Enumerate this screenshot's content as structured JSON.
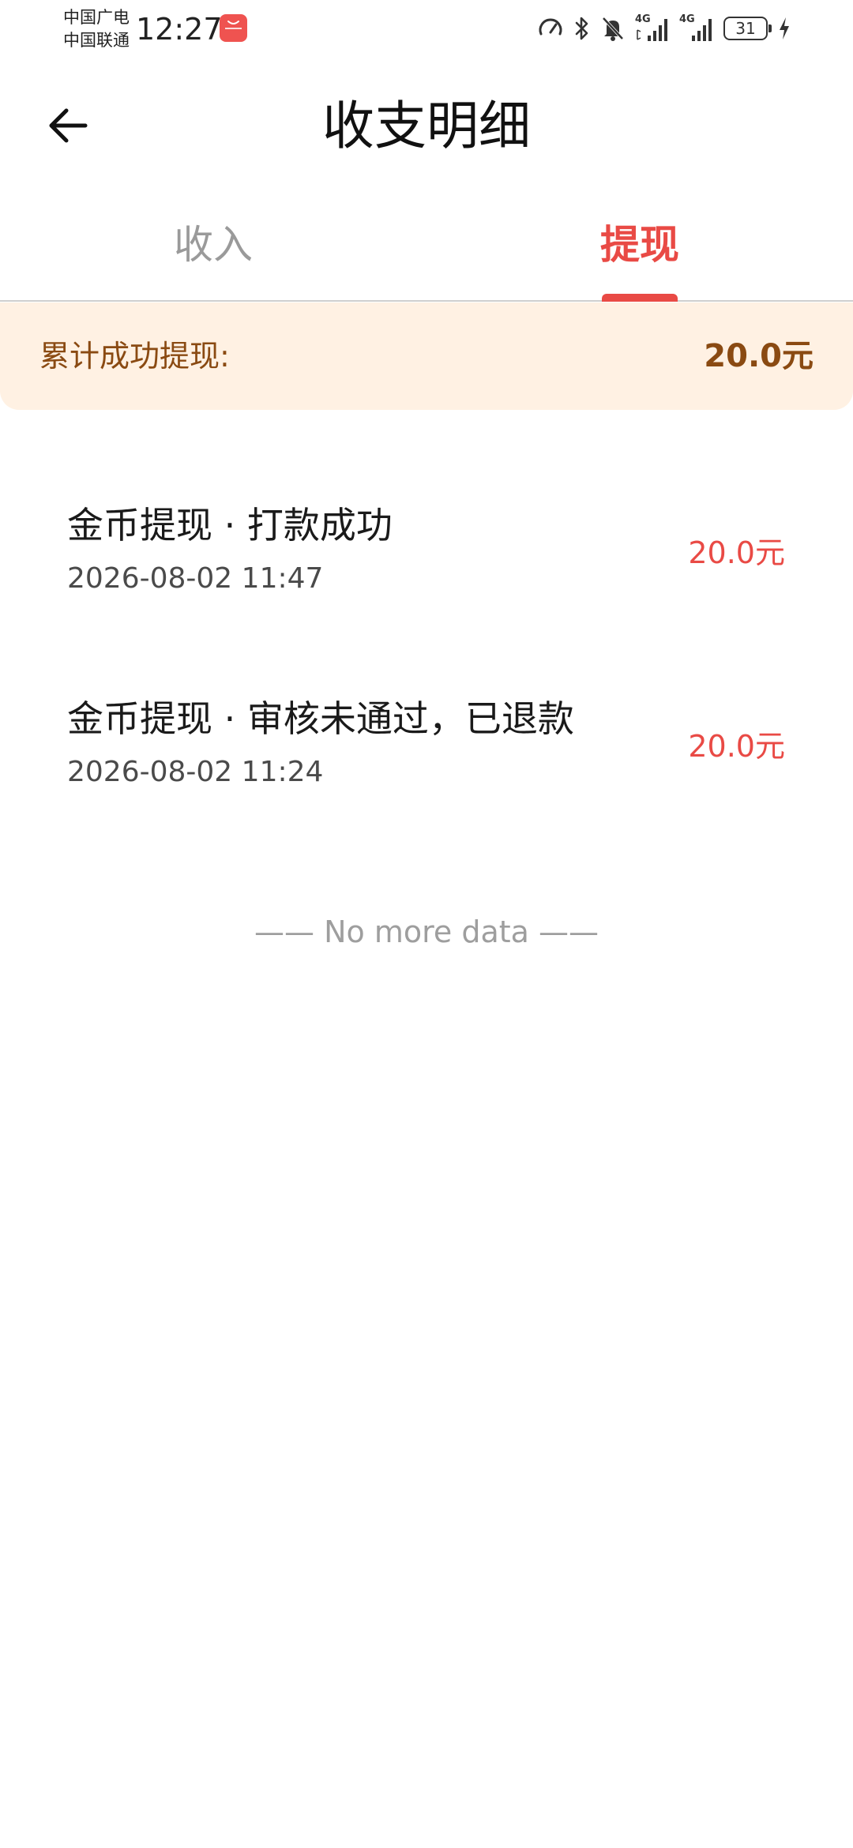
{
  "status_bar": {
    "carrier_1": "中国广电",
    "carrier_2": "中国联通",
    "time": "12:27",
    "network_1": "4G",
    "network_2": "4G",
    "battery": "31",
    "icons": [
      "speed-icon",
      "bluetooth-icon",
      "bell-muted-icon",
      "signal-icon",
      "signal-icon",
      "battery-icon",
      "charging-icon"
    ]
  },
  "header": {
    "title": "收支明细",
    "back_icon": "arrow-left-icon"
  },
  "tabs": [
    {
      "label": "收入",
      "active": false
    },
    {
      "label": "提现",
      "active": true
    }
  ],
  "summary": {
    "label": "累计成功提现:",
    "amount": "20.0元"
  },
  "records": [
    {
      "title": "金币提现 · 打款成功",
      "time": "2026-08-02 11:47",
      "amount": "20.0元"
    },
    {
      "title": "金币提现 · 审核未通过，已退款",
      "time": "2026-08-02 11:24",
      "amount": "20.0元"
    }
  ],
  "footer": {
    "no_more": "—— No more data ——"
  },
  "colors": {
    "accent": "#e94a45",
    "summary_bg": "#fff1e3",
    "summary_text": "#8a4a12",
    "inactive_tab": "#9a9a9a"
  }
}
